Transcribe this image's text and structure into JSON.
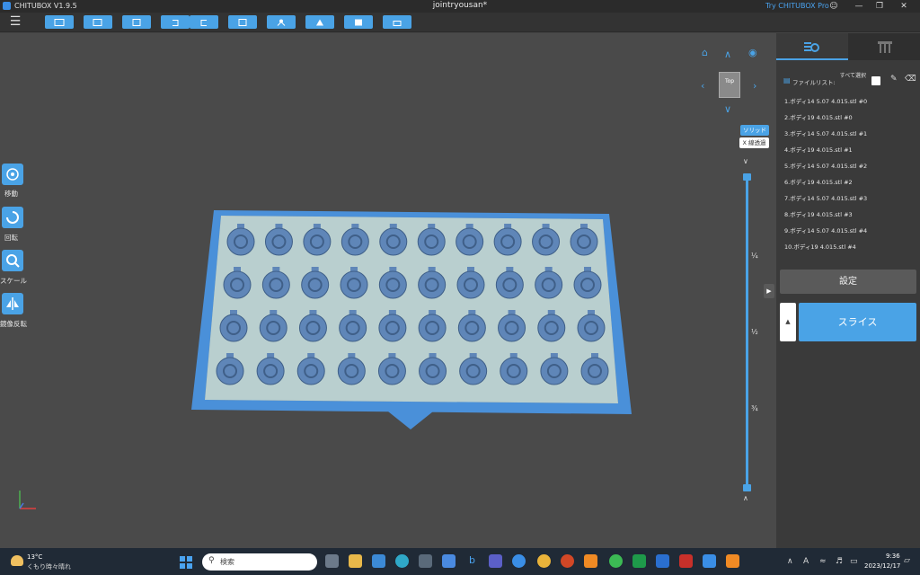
{
  "app": {
    "title": "CHITUBOX V1.9.5",
    "document_title": "jointryousan*",
    "try_pro": "Try CHITUBOX Pro"
  },
  "toolbar": {
    "buttons": [
      "open-icon",
      "save-icon",
      "import-icon",
      "undo-icon",
      "redo-icon",
      "export-icon",
      "support-icon",
      "hollow-icon",
      "layout-icon",
      "print-icon"
    ]
  },
  "left_tools": [
    {
      "label": "移動",
      "icon": "move-icon"
    },
    {
      "label": "回転",
      "icon": "rotate-icon"
    },
    {
      "label": "スケール",
      "icon": "scale-icon"
    },
    {
      "label": "鏡像反転",
      "icon": "mirror-icon"
    }
  ],
  "view": {
    "cube_label": "Top",
    "solid_label": "ソリッド",
    "xray_label": "X 線透過"
  },
  "slider": {
    "fractions": [
      "¼",
      "½",
      "¾"
    ]
  },
  "panel": {
    "file_list_label": "ファイルリスト:",
    "select_all_label": "すべて選択",
    "files": [
      "1.ボディ14 5.07 4.015.stl #0",
      "2.ボディ19 4.015.stl #0",
      "3.ボディ14 5.07 4.015.stl #1",
      "4.ボディ19 4.015.stl #1",
      "5.ボディ14 5.07 4.015.stl #2",
      "6.ボディ19 4.015.stl #2",
      "7.ボディ14 5.07 4.015.stl #3",
      "8.ボディ19 4.015.stl #3",
      "9.ボディ14 5.07 4.015.stl #4",
      "10.ボディ19 4.015.stl #4"
    ],
    "settings_label": "設定",
    "slice_label": "スライス"
  },
  "taskbar": {
    "weather_temp": "13°C",
    "weather_desc": "くもり時々晴れ",
    "search_placeholder": "検索",
    "time": "9:36",
    "date": "2023/12/17"
  },
  "colors": {
    "accent": "#4aa3e6",
    "plate": "#4a90d9",
    "parts": "#5f86b8"
  }
}
